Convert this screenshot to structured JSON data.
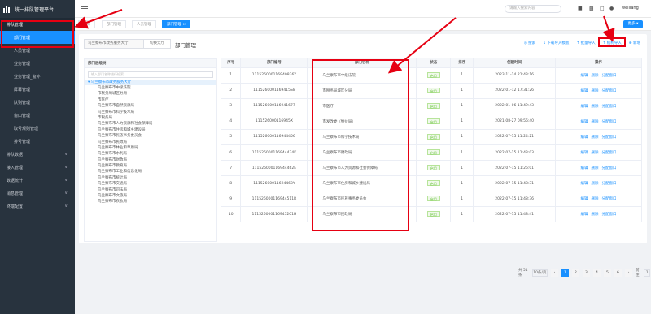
{
  "app": {
    "title": "统一排队管理平台"
  },
  "sidebar": {
    "items": [
      {
        "label": "排队管理",
        "type": "group"
      },
      {
        "label": "部门管理",
        "type": "active"
      },
      {
        "label": "人员管理",
        "type": "sub"
      },
      {
        "label": "业务管理",
        "type": "sub"
      },
      {
        "label": "业务管理_窗外",
        "type": "sub"
      },
      {
        "label": "屏幕管理",
        "type": "sub"
      },
      {
        "label": "队列管理",
        "type": "sub"
      },
      {
        "label": "窗口管理",
        "type": "sub"
      },
      {
        "label": "取号规则管理",
        "type": "sub"
      },
      {
        "label": "排号管理",
        "type": "sub"
      },
      {
        "label": "排队数据",
        "type": "group-caret"
      },
      {
        "label": "接入管理",
        "type": "group-caret"
      },
      {
        "label": "数据统计",
        "type": "group-caret"
      },
      {
        "label": "消息管理",
        "type": "group-caret"
      },
      {
        "label": "终端配置",
        "type": "group-caret"
      }
    ]
  },
  "header": {
    "search_placeholder": "请输入搜索内容",
    "user": "weiliang"
  },
  "tabs": [
    {
      "label": "首页"
    },
    {
      "label": "部门管理"
    },
    {
      "label": "人员管理"
    },
    {
      "label": "部门管理 ×",
      "active": true
    }
  ],
  "more_button": "更多 ▾",
  "toolbar": {
    "dept_input": "乌兰察布市政务服务大厅",
    "dept_button": "切换大厅",
    "title": "部门管理",
    "actions": [
      "◎ 搜索",
      "↓ 下载导入模板",
      "↑ 批量导入",
      "↑ 机构导入",
      "⊕ 新增"
    ]
  },
  "tree": {
    "header": "部门层级树",
    "filter_placeholder": "输入部门名称进行检索",
    "root": "▾ 乌兰察布市政务服务大厅",
    "nodes": [
      "乌兰察布市中级法院",
      "市税务局城区分局",
      "市医疗",
      "乌兰察布市自然资源局",
      "乌兰察布市科学技术局",
      "市税务局",
      "乌兰察布市人力资源和社会保障局",
      "乌兰察布市住房和城乡建设局",
      "乌兰察布市民族事务委员会",
      "乌兰察布市民政局",
      "乌兰察布市林业和草原局",
      "乌兰察布市水利局",
      "乌兰察布市财政局",
      "乌兰察布市教育局",
      "乌兰察布市工业和信息化局",
      "乌兰察布市统计局",
      "乌兰察布市交通局",
      "乌兰察布市司法局",
      "乌兰察布市文旅局",
      "乌兰察布市农牧局"
    ]
  },
  "table": {
    "headers": [
      "序号",
      "部门编号",
      "部门名称",
      "状态",
      "排序",
      "创建时间",
      "操作"
    ],
    "status_label": "启用",
    "ops": [
      "编辑",
      "删除",
      "分配窗口"
    ],
    "rows": [
      {
        "no": "1",
        "code": "111526000116940836Y",
        "name": "乌兰察布市中级法院",
        "sort": "1",
        "time": "2023-11-14 21:43:16"
      },
      {
        "no": "2",
        "code": "1115260001169415S8",
        "name": "市税务局城区分局",
        "sort": "1",
        "time": "2022-01-12 17:31:26"
      },
      {
        "no": "3",
        "code": "111526000116941677",
        "name": "市医疗",
        "sort": "1",
        "time": "2022-01-06 11:49:43"
      },
      {
        "no": "4",
        "code": "111526000116945X",
        "name": "市发改委（物价局）",
        "sort": "1",
        "time": "2021-08-27 09:56:40"
      },
      {
        "no": "5",
        "code": "111526000116944456",
        "name": "乌兰察布市科学技术局",
        "sort": "1",
        "time": "2022-07-15 11:24:21"
      },
      {
        "no": "6",
        "code": "111526000116944474K",
        "name": "乌兰察布市财政局",
        "sort": "1",
        "time": "2022-07-15 11:43:03"
      },
      {
        "no": "7",
        "code": "111526000116944462E",
        "name": "乌兰察布市人力资源和社会保障局",
        "sort": "1",
        "time": "2022-07-15 11:26:01"
      },
      {
        "no": "8",
        "code": "11152600011694463Y",
        "name": "乌兰察布市住房和城乡建设局",
        "sort": "1",
        "time": "2022-07-15 11:48:31"
      },
      {
        "no": "9",
        "code": "111526000116944511R",
        "name": "乌兰察布市民族事务委员会",
        "sort": "1",
        "time": "2022-07-15 11:48:36"
      },
      {
        "no": "10",
        "code": "111526000116945201H",
        "name": "乌兰察布市民政局",
        "sort": "1",
        "time": "2022-07-15 11:48:41"
      }
    ]
  },
  "pager": {
    "total": "共 51 条",
    "size": "10条/页",
    "pages": [
      "1",
      "2",
      "3",
      "4",
      "5",
      "6"
    ],
    "goto": "前往",
    "page_input": "1",
    "page_unit": "页"
  }
}
